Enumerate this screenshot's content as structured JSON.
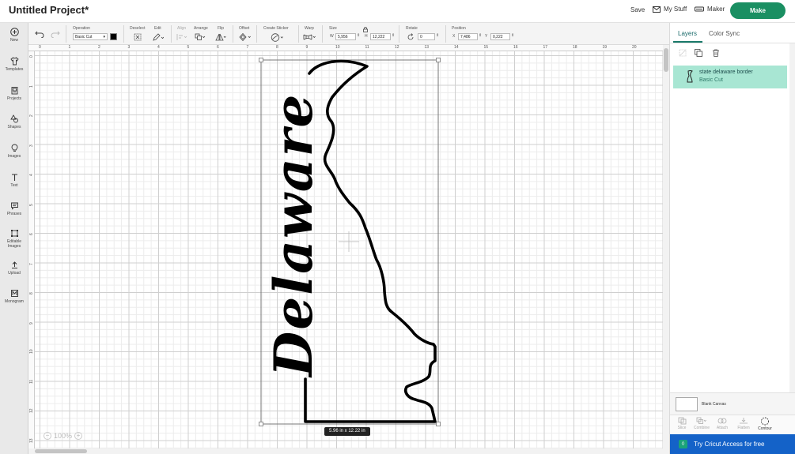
{
  "header": {
    "project_title": "Untitled Project*",
    "save_label": "Save",
    "mystuff_label": "My Stuff",
    "maker_label": "Maker",
    "make_label": "Make"
  },
  "sidebar": {
    "items": [
      {
        "label": "New",
        "icon": "plus-circle-icon"
      },
      {
        "label": "Templates",
        "icon": "shirt-icon"
      },
      {
        "label": "Projects",
        "icon": "projects-icon"
      },
      {
        "label": "Shapes",
        "icon": "shapes-icon"
      },
      {
        "label": "Images",
        "icon": "bulb-icon"
      },
      {
        "label": "Text",
        "icon": "text-icon"
      },
      {
        "label": "Phrases",
        "icon": "speech-icon"
      },
      {
        "label": "Editable",
        "label2": "Images",
        "icon": "editable-images-icon"
      },
      {
        "label": "Upload",
        "icon": "upload-icon"
      },
      {
        "label": "Monogram",
        "icon": "monogram-icon"
      }
    ]
  },
  "toolbar": {
    "operation_label": "Operation",
    "operation_value": "Basic Cut",
    "deselect_label": "Deselect",
    "edit_label": "Edit",
    "align_label": "Align",
    "arrange_label": "Arrange",
    "flip_label": "Flip",
    "offset_label": "Offset",
    "sticker_label": "Create Sticker",
    "warp_label": "Warp",
    "size_label": "Size",
    "w_label": "W",
    "w_value": "5,956",
    "h_label": "H",
    "h_value": "12,222",
    "rotate_label": "Rotate",
    "rotate_value": "0",
    "position_label": "Position",
    "x_label": "X",
    "x_value": "7,486",
    "y_label": "Y",
    "y_value": "0,222",
    "swatch_color": "#000000"
  },
  "canvas": {
    "ruler_top": [
      "0",
      "1",
      "2",
      "3",
      "4",
      "5",
      "6",
      "7",
      "8",
      "9",
      "10",
      "11",
      "12",
      "13",
      "14",
      "15",
      "16",
      "17",
      "18",
      "19",
      "20"
    ],
    "ruler_left": [
      "0",
      "1",
      "2",
      "3",
      "4",
      "5",
      "6",
      "7",
      "8",
      "9",
      "10",
      "11",
      "12",
      "13"
    ],
    "design_word": "Delaware",
    "size_tag": "5.96  in x 12.22  in",
    "zoom_value": "100%"
  },
  "right_panel": {
    "tabs": [
      "Layers",
      "Color Sync"
    ],
    "layer": {
      "name": "state delaware border",
      "operation": "Basic Cut"
    },
    "blank_canvas_label": "Blank Canvas",
    "tools": [
      "Slice",
      "Combine",
      "Attach",
      "Flatten",
      "Contour"
    ],
    "access_label": "Try Cricut Access for free",
    "accent_color": "#1a8f62",
    "banner_color": "#1462c8"
  }
}
